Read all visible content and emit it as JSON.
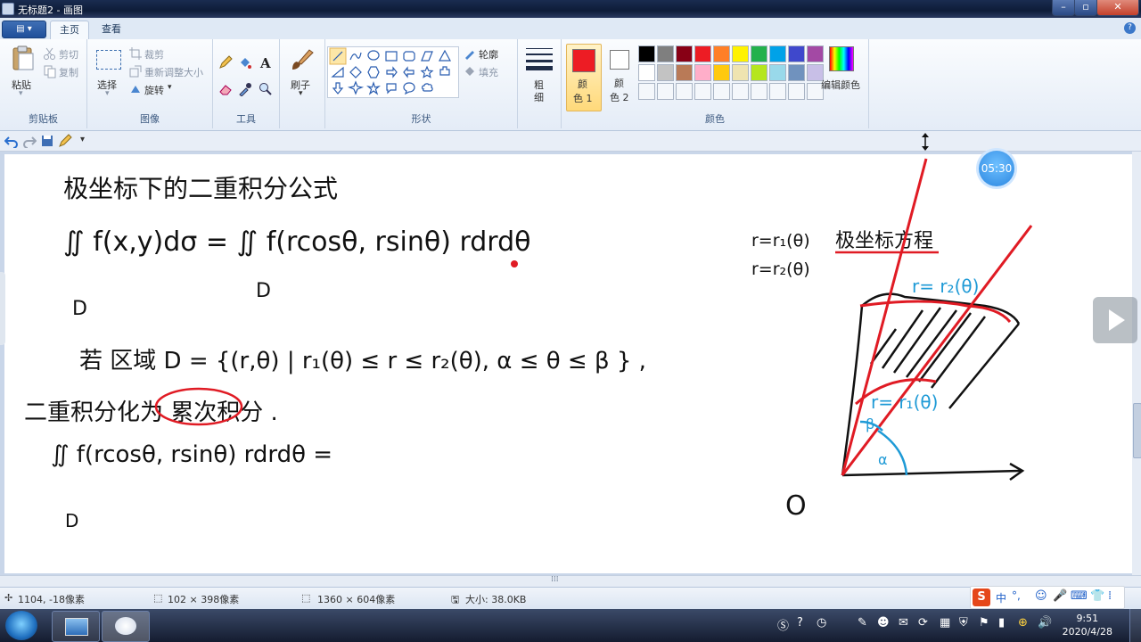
{
  "window": {
    "title": "无标题2 - 画图",
    "controls": {
      "minimize": "–",
      "maximize": "▫",
      "close": "✕"
    }
  },
  "tabs": [
    {
      "label": "主页",
      "active": true
    },
    {
      "label": "查看",
      "active": false
    }
  ],
  "ribbon": {
    "clipboard": {
      "label": "剪贴板",
      "paste": "粘贴",
      "cut": "剪切",
      "copy": "复制"
    },
    "image": {
      "label": "图像",
      "select": "选择",
      "crop": "裁剪",
      "resize": "重新调整大小",
      "rotate": "旋转"
    },
    "tools": {
      "label": "工具"
    },
    "brushes": {
      "label": "刷子"
    },
    "shapes": {
      "label": "形状",
      "outline": "轮廓",
      "fill": "填充"
    },
    "size": {
      "label_line1": "粗",
      "label_line2": "细"
    },
    "colors": {
      "label": "颜色",
      "color1_line1": "颜",
      "color1_line2": "色 1",
      "color2_line1": "颜",
      "color2_line2": "色 2",
      "edit": "编辑颜色",
      "color1_value": "#ed1c24",
      "color2_value": "#ffffff",
      "palette_row1": [
        "#000000",
        "#7f7f7f",
        "#880015",
        "#ed1c24",
        "#ff7f27",
        "#fff200",
        "#22b14c",
        "#00a2e8",
        "#3f48cc",
        "#a349a4"
      ],
      "palette_row2": [
        "#ffffff",
        "#c3c3c3",
        "#b97a57",
        "#ffaec9",
        "#ffc90e",
        "#efe4b0",
        "#b5e61d",
        "#99d9ea",
        "#7092be",
        "#c8bfe7"
      ]
    }
  },
  "canvas": {
    "lines": {
      "title": "极坐标下的二重积分公式",
      "formula_left": "∬ f(x,y)dσ = ∬ f(rcosθ, rsinθ) rdrdθ",
      "D1": "D",
      "D2": "D",
      "region": "若 区域 D = {(r,θ) | r₁(θ) ≤ r ≤ r₂(θ),   α ≤ θ ≤ β } ,",
      "convert": "二重积分化为 累次积分 .",
      "integral2": "∬ f(rcosθ, rsinθ) rdrdθ =",
      "D3": "D",
      "r1": "r=r₁(θ)",
      "r2": "r=r₂(θ)",
      "polar_eq": "极坐标方程",
      "curve_r2": "r= r₂(θ)",
      "curve_r1": "r= r₁(θ)",
      "beta": "β",
      "alpha": "α",
      "origin": "O"
    }
  },
  "timer": "05:30",
  "status": {
    "cursor": "1104, -18像素",
    "selection": "102 × 398像素",
    "canvas_size": "1360 × 604像素",
    "file_size": "大小: 38.0KB"
  },
  "ime": {
    "lang": "中",
    "punct": "°,"
  },
  "clock": {
    "time": "9:51",
    "date": "2020/4/28"
  }
}
